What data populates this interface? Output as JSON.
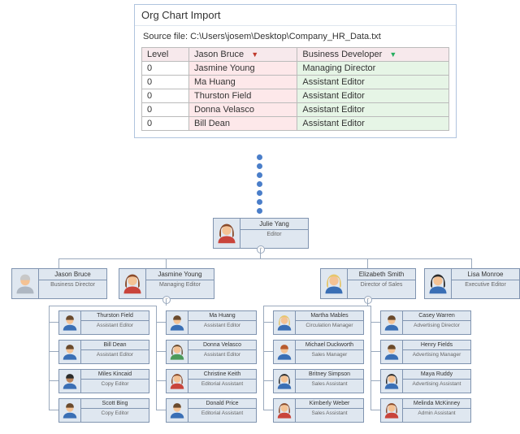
{
  "window": {
    "title": "Org Chart Import",
    "source_label": "Source file:",
    "source_path": "C:\\Users\\josem\\Desktop\\Company_HR_Data.txt",
    "columns": {
      "level": "Level",
      "name": "Jason Bruce",
      "role": "Business Developer"
    },
    "rows": [
      {
        "level": "0",
        "name": "Jasmine Young",
        "role": "Managing Director"
      },
      {
        "level": "0",
        "name": "Ma Huang",
        "role": "Assistant Editor"
      },
      {
        "level": "0",
        "name": "Thurston Field",
        "role": "Assistant Editor"
      },
      {
        "level": "0",
        "name": "Donna Velasco",
        "role": "Assistant Editor"
      },
      {
        "level": "0",
        "name": "Bill Dean",
        "role": "Assistant Editor"
      }
    ]
  },
  "chart": {
    "root": {
      "name": "Julie Yang",
      "role": "Editor",
      "avatar": "female-brown"
    },
    "managers": [
      {
        "name": "Jason Bruce",
        "role": "Business Director",
        "avatar": "male-gray"
      },
      {
        "name": "Jasmine Young",
        "role": "Managing Editor",
        "avatar": "female-brown"
      },
      {
        "name": "Elizabeth Smith",
        "role": "Director of Sales",
        "avatar": "female-blonde"
      },
      {
        "name": "Lisa Monroe",
        "role": "Executive Editor",
        "avatar": "female-dark"
      }
    ],
    "columns": [
      [
        {
          "name": "Thurston Field",
          "role": "Assistant Editor",
          "avatar": "male-blue"
        },
        {
          "name": "Bill Dean",
          "role": "Assistant Editor",
          "avatar": "male-blue"
        },
        {
          "name": "Miles Kincaid",
          "role": "Copy Editor",
          "avatar": "male-dark"
        },
        {
          "name": "Scott Bing",
          "role": "Copy Editor",
          "avatar": "male-blue"
        }
      ],
      [
        {
          "name": "Ma Huang",
          "role": "Assistant Editor",
          "avatar": "male-blue"
        },
        {
          "name": "Donna Velasco",
          "role": "Assistant Editor",
          "avatar": "female-green"
        },
        {
          "name": "Christine Keith",
          "role": "Editorial Assistant",
          "avatar": "female-brown"
        },
        {
          "name": "Donald Price",
          "role": "Editorial Assistant",
          "avatar": "male-blue"
        }
      ],
      [
        {
          "name": "Martha Mables",
          "role": "Circulation Manager",
          "avatar": "female-blonde"
        },
        {
          "name": "Michael Duckworth",
          "role": "Sales Manager",
          "avatar": "male-red"
        },
        {
          "name": "Britney Simpson",
          "role": "Sales Assistant",
          "avatar": "female-dark"
        },
        {
          "name": "Kimberly Weber",
          "role": "Sales Assistant",
          "avatar": "female-brown"
        }
      ],
      [
        {
          "name": "Casey Warren",
          "role": "Advertising Director",
          "avatar": "male-blue"
        },
        {
          "name": "Henry Fields",
          "role": "Advertising Manager",
          "avatar": "male-blue"
        },
        {
          "name": "Maya Ruddy",
          "role": "Advertising Assistant",
          "avatar": "female-dark"
        },
        {
          "name": "Melinda McKinney",
          "role": "Admin Assistant",
          "avatar": "female-brown"
        }
      ]
    ]
  },
  "avatars": {
    "male-gray": {
      "hair": "#c8c8c8",
      "skin": "#f4c294",
      "shirt": "#aeb7c2"
    },
    "male-blue": {
      "hair": "#6a4a2c",
      "skin": "#f4c294",
      "shirt": "#3a6fb5"
    },
    "male-dark": {
      "hair": "#2b2b2b",
      "skin": "#b9825a",
      "shirt": "#3a6fb5"
    },
    "male-red": {
      "hair": "#b85b2e",
      "skin": "#f4c294",
      "shirt": "#3a6fb5"
    },
    "female-brown": {
      "hair": "#8a4b2a",
      "skin": "#f4c294",
      "shirt": "#c9443b"
    },
    "female-blonde": {
      "hair": "#e6c66b",
      "skin": "#f4c294",
      "shirt": "#3a6fb5"
    },
    "female-dark": {
      "hair": "#2b2b2b",
      "skin": "#f4c294",
      "shirt": "#3a6fb5"
    },
    "female-green": {
      "hair": "#6a4a2c",
      "skin": "#f4c294",
      "shirt": "#4a9a5a"
    }
  }
}
